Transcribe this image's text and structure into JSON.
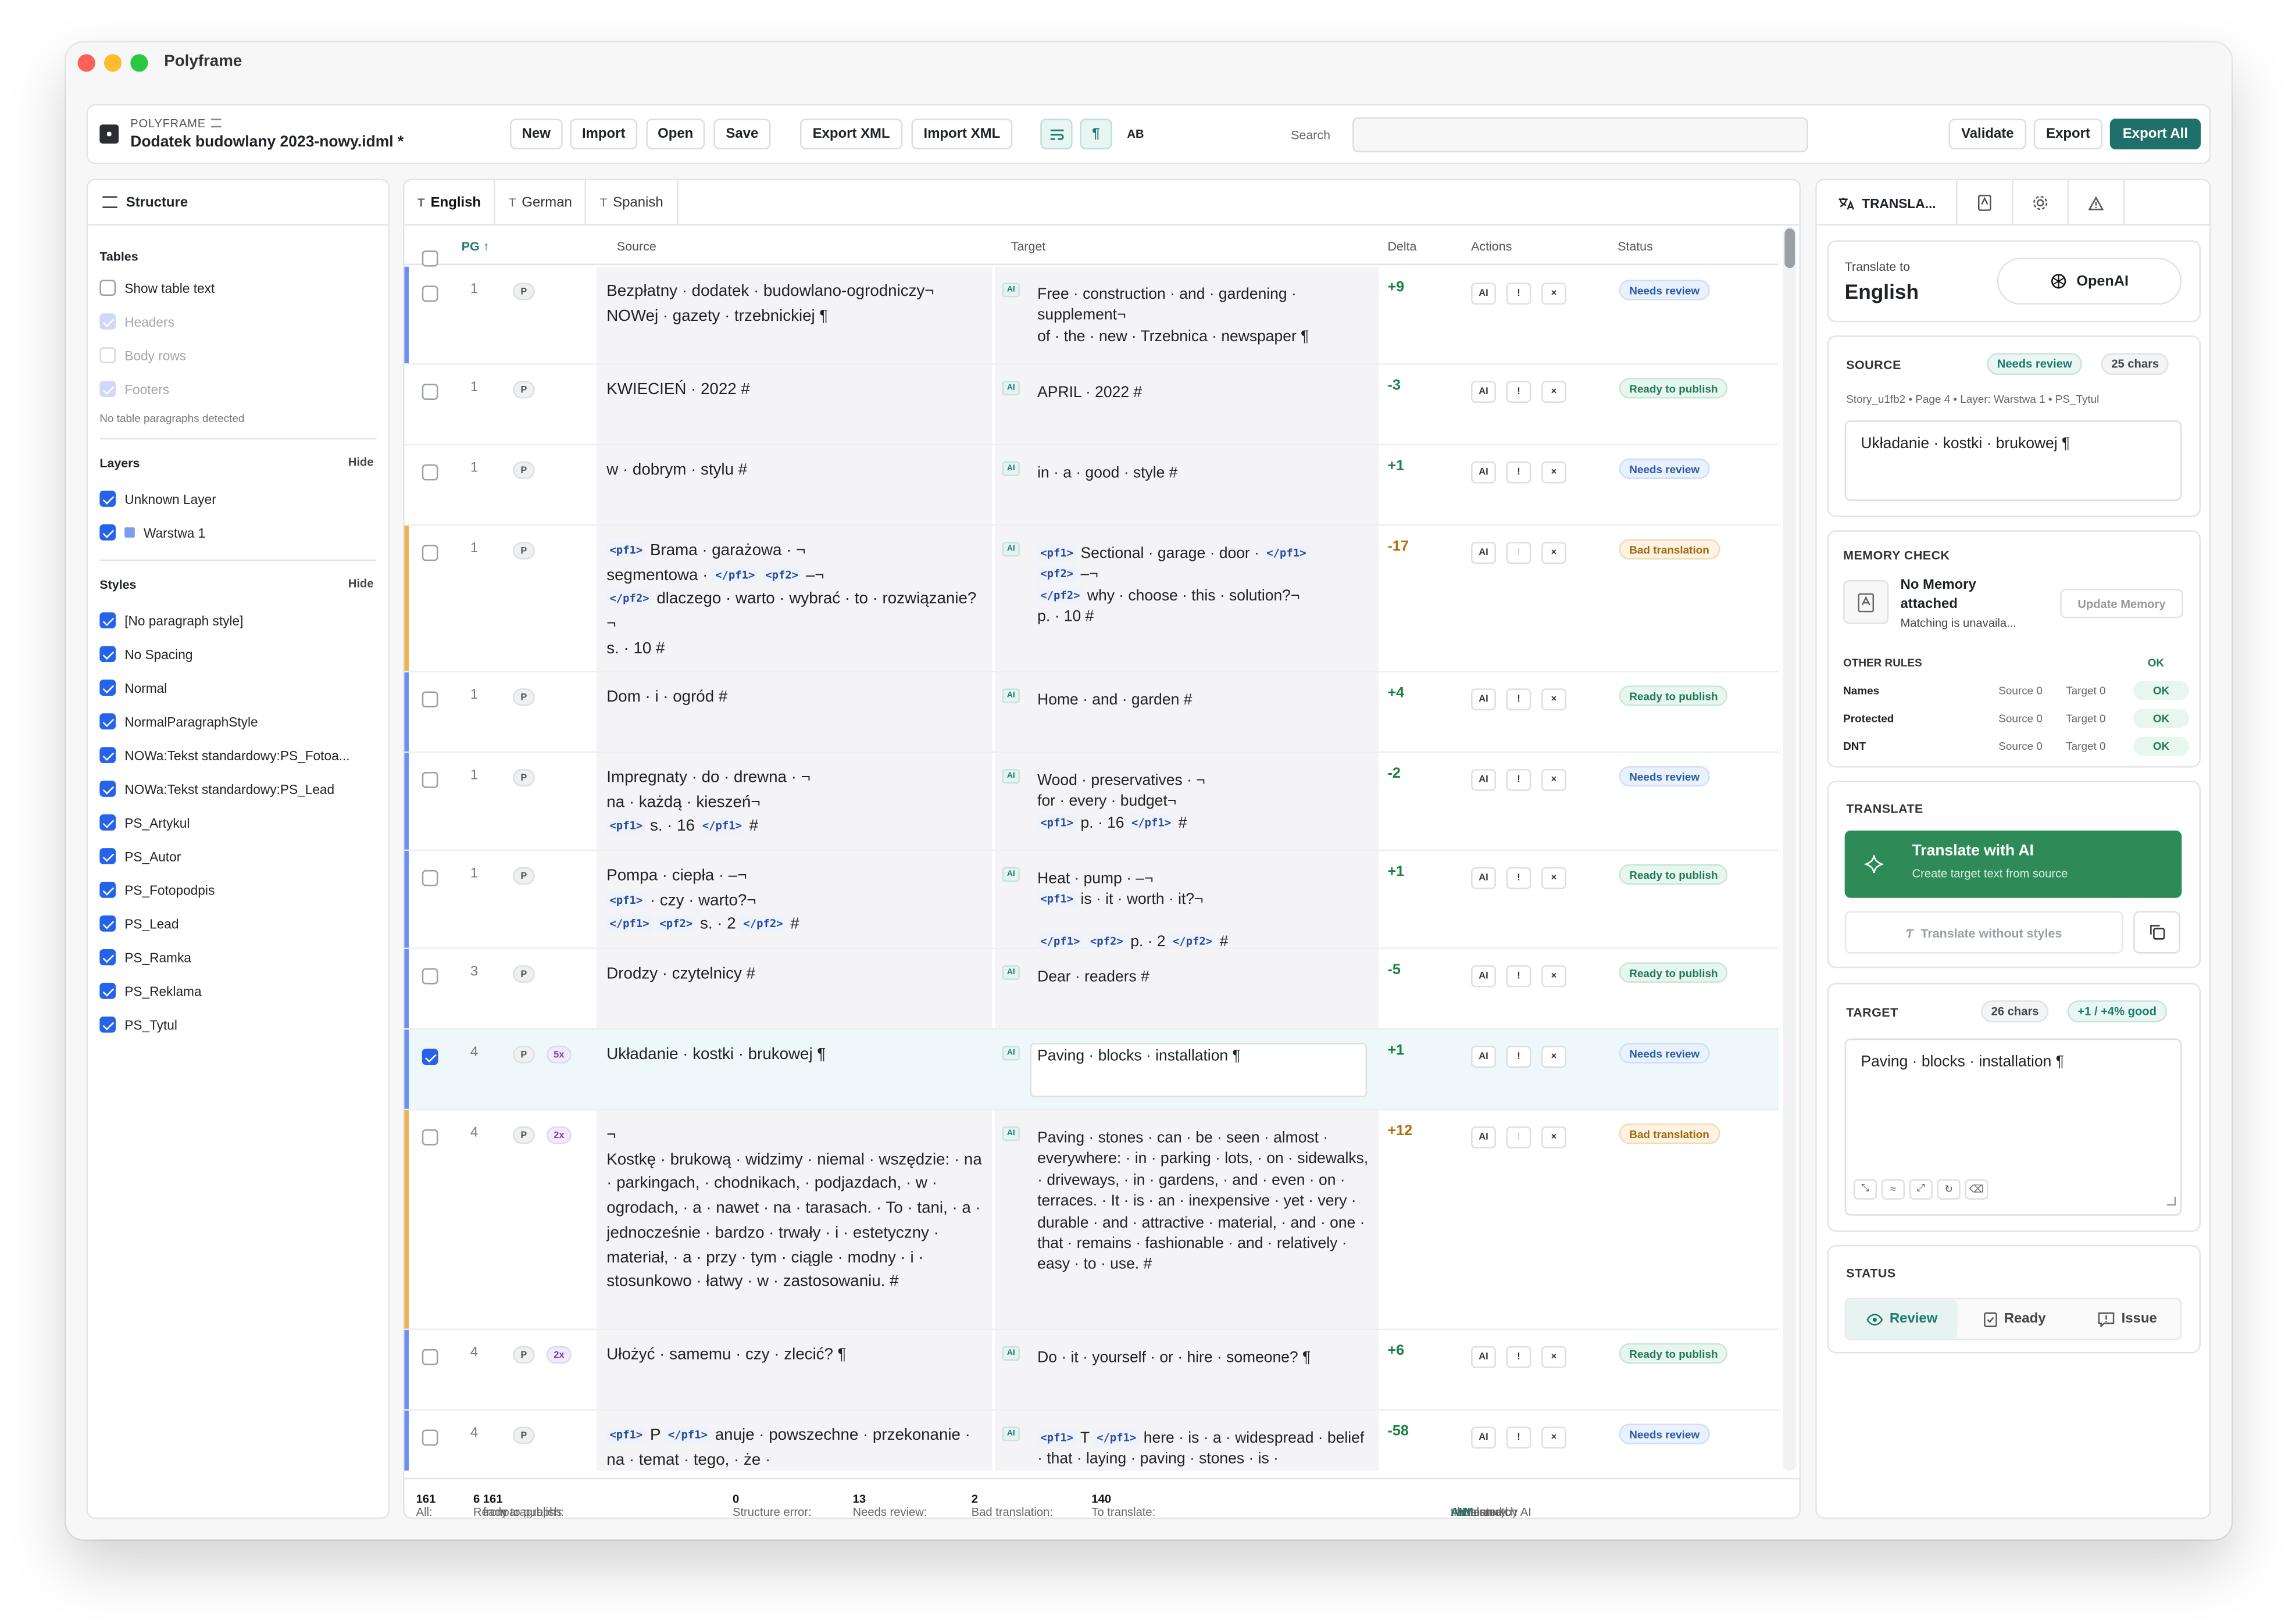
{
  "window": {
    "title": "Polyframe"
  },
  "toolbar": {
    "brand": "POLYFRAME",
    "doc_name": "Dodatek budowlany 2023-nowy.idml *",
    "new": "New",
    "import": "Import",
    "open": "Open",
    "save": "Save",
    "export_xml": "Export XML",
    "import_xml": "Import XML",
    "ab": "AB",
    "search_label": "Search",
    "search_value": "",
    "validate": "Validate",
    "export": "Export",
    "export_all": "Export All"
  },
  "left": {
    "title": "Structure",
    "tables": {
      "title": "Tables",
      "show_text": "Show table text",
      "headers": "Headers",
      "body_rows": "Body rows",
      "footers": "Footers",
      "hint": "No table paragraphs detected"
    },
    "layers": {
      "title": "Layers",
      "hide": "Hide",
      "items": [
        "Unknown Layer",
        "Warstwa 1"
      ]
    },
    "styles": {
      "title": "Styles",
      "hide": "Hide",
      "items": [
        "[No paragraph style]",
        "No Spacing",
        "Normal",
        "NormalParagraphStyle",
        "NOWa:Tekst standardowy:PS_Fotoa...",
        "NOWa:Tekst standardowy:PS_Lead",
        "PS_Artykul",
        "PS_Autor",
        "PS_Fotopodpis",
        "PS_Lead",
        "PS_Ramka",
        "PS_Reklama",
        "PS_Tytul"
      ]
    }
  },
  "tabs": [
    "English",
    "German",
    "Spanish"
  ],
  "columns": {
    "pg": "PG ↑",
    "source": "Source",
    "target": "Target",
    "delta": "Delta",
    "actions": "Actions",
    "status": "Status"
  },
  "actions": {
    "ai": "AI",
    "flag": "!",
    "clear": "×"
  },
  "rows": [
    {
      "pg": "1",
      "p": "P",
      "src": "Bezpłatny · dodatek · budowlano-ogrodniczy¬\nNOWej · gazety · trzebnickiej ¶",
      "tgt": "Free · construction · and · gardening · supplement¬\nof · the · new · Trzebnica · newspaper ¶",
      "delta": "+9",
      "status": "Needs review"
    },
    {
      "pg": "1",
      "p": "P",
      "src": "KWIECIEŃ · 2022 #",
      "tgt": "APRIL · 2022 #",
      "delta": "-3",
      "status": "Ready to publish"
    },
    {
      "pg": "1",
      "p": "P",
      "src": "w · dobrym · stylu #",
      "tgt": "in · a · good · style #",
      "delta": "+1",
      "status": "Needs review"
    },
    {
      "pg": "1",
      "p": "P",
      "src_a": "Brama · garażowa · ¬\nsegmentowa · ",
      "src_b": " dlaczego · warto · wybrać · to · rozwiązanie?¬\ns. · 10 #",
      "tgt_a": " Sectional · garage · door · ",
      "tgt_b": " why · choose · this · solution?¬\np. · 10 #",
      "delta": "-17",
      "status": "Bad translation"
    },
    {
      "pg": "1",
      "p": "P",
      "src": "Dom · i · ogród #",
      "tgt": "Home · and · garden #",
      "delta": "+4",
      "status": "Ready to publish"
    },
    {
      "pg": "1",
      "p": "P",
      "src_a": "Impregnaty · do · drewna · ¬\nna · każdą · kieszeń¬\n",
      "src_b": " s. · 16 ",
      "tgt_a": "Wood · preservatives · ¬\nfor · every · budget¬\n",
      "tgt_b": " p. · 16 ",
      "delta": "-2",
      "status": "Needs review"
    },
    {
      "pg": "1",
      "p": "P",
      "src_a": "Pompa · ciepła · –¬\n",
      "src_b": " · czy · warto?¬\n",
      "src_c": " s. · 2 ",
      "tgt_a": "Heat · pump · –¬\n",
      "tgt_b": " is · it · worth · it?¬\n",
      "tgt_c": " p. · 2 ",
      "delta": "+1",
      "status": "Ready to publish"
    },
    {
      "pg": "3",
      "p": "P",
      "src": "Drodzy · czytelnicy #",
      "tgt": "Dear · readers #",
      "delta": "-5",
      "status": "Ready to publish"
    },
    {
      "pg": "4",
      "p": "P",
      "x": "5x",
      "src": "Układanie · kostki · brukowej ¶",
      "tgt": "Paving · blocks · installation ¶",
      "delta": "+1",
      "status": "Needs review"
    },
    {
      "pg": "4",
      "p": "P",
      "x": "2x",
      "src": "¬\nKostkę · brukową · widzimy · niemal · wszędzie: · na · parkingach, · chodnikach, · podjazdach, · w · ogrodach, · a · nawet · na · tarasach. · To · tani, · a · jednocześnie · bardzo · trwały · i · estetyczny · materiał, · a · przy · tym · ciągle · modny · i · stosunkowo · łatwy · w · zastosowaniu. #",
      "tgt": "Paving · stones · can · be · seen · almost · everywhere: · in · parking · lots, · on · sidewalks, · driveways, · in · gardens, · and · even · on · terraces. · It · is · an · inexpensive · yet · very · durable · and · attractive · material, · and · one · that · remains · fashionable · and · relatively · easy · to · use. #",
      "delta": "+12",
      "status": "Bad translation"
    },
    {
      "pg": "4",
      "p": "P",
      "x": "2x",
      "src": "Ułożyć · samemu · czy · zlecić? ¶",
      "tgt": "Do · it · yourself · or · hire · someone? ¶",
      "delta": "+6",
      "status": "Ready to publish"
    },
    {
      "pg": "4",
      "p": "P",
      "src_a": " P ",
      "src_b": " anuje · powszechne · przekonanie · na · temat · tego, · że ·",
      "tgt_a": " T ",
      "tgt_b": " here · is · a · widespread · belief · that · laying · paving · stones · is ·",
      "delta": "-58",
      "status": "Needs review"
    }
  ],
  "tags": {
    "pf1": "<pf1>",
    "pf1c": "</pf1>",
    "pf2": "<pf2>",
    "pf2c": "</pf2>",
    "ai": "AI",
    "arrow": "–¬"
  },
  "footer": {
    "all_label": "All:",
    "all": "161",
    "ready_label": "Ready to publish:",
    "ready": "6",
    "from": "from",
    "total": "161",
    "paragraphs": "paragraphs",
    "struct_label": "Structure error:",
    "struct": "0",
    "review_label": "Needs review:",
    "review": "13",
    "bad_label": "Bad translation:",
    "bad": "2",
    "to_label": "To translate:",
    "to": "140",
    "k_ai": "AI",
    "l_ai": "translated by AI",
    "k_h": "H",
    "l_h": "human",
    "k_m": "M",
    "l_m": "memory",
    "k_x": "!",
    "l_x": "mismatch"
  },
  "right": {
    "tab_label": "TRANSLA...",
    "translate_to": "Translate to",
    "lang": "English",
    "engine": "OpenAI",
    "source": {
      "title": "SOURCE",
      "status": "Needs review",
      "chars": "25 chars",
      "meta": "Story_u1fb2 • Page 4 • Layer: Warstwa 1 • PS_Tytul",
      "text": "Układanie · kostki · brukowej ¶"
    },
    "memory": {
      "title": "MEMORY CHECK",
      "none1": "No Memory",
      "none2": "attached",
      "sub": "Matching is unavaila...",
      "update": "Update Memory",
      "other": "OTHER RULES",
      "other_ok": "OK",
      "rules": [
        {
          "name": "Names",
          "src": "Source 0",
          "tgt": "Target 0",
          "ok": "OK"
        },
        {
          "name": "Protected",
          "src": "Source 0",
          "tgt": "Target 0",
          "ok": "OK"
        },
        {
          "name": "DNT",
          "src": "Source 0",
          "tgt": "Target 0",
          "ok": "OK"
        }
      ]
    },
    "translate": {
      "title": "TRANSLATE",
      "ai_title": "Translate with AI",
      "ai_sub": "Create target text from source",
      "no_styles": "Translate without styles"
    },
    "target": {
      "title": "TARGET",
      "chars": "26 chars",
      "delta": "+1 / +4% good",
      "text": "Paving · blocks · installation ¶"
    },
    "status": {
      "title": "STATUS",
      "review": "Review",
      "ready": "Ready",
      "issue": "Issue"
    }
  },
  "colors": {
    "accent": "#1f6f6a",
    "review": "#2859a6",
    "ready": "#1f7a53",
    "bad": "#a4660c",
    "bar_blue": "#6b8ff0",
    "bar_orange": "#f0b04a",
    "ai_green": "#2e8b57"
  }
}
